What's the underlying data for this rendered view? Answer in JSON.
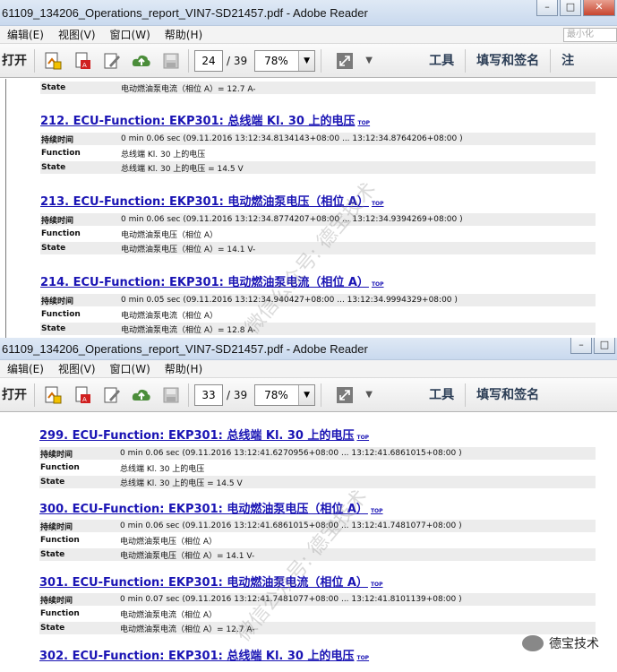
{
  "windows": [
    {
      "title": "61109_134206_Operations_report_VIN7-SD21457.pdf - Adobe Reader",
      "menu": [
        "编辑(E)",
        "视图(V)",
        "窗口(W)",
        "帮助(H)"
      ],
      "search_placeholder": "最小化",
      "open_label": "打开",
      "page_current": "24",
      "page_total": "/ 39",
      "zoom": "78%",
      "right_links": [
        "工具",
        "填写和签名",
        "注"
      ],
      "top_row": {
        "key": "State",
        "value": "电动燃油泵电流（相位 A）= 12.7 A-"
      },
      "sections": [
        {
          "title": "212. ECU-Function: EKP301: 总线端 Kl. 30 上的电压",
          "top": "TOP",
          "rows": [
            {
              "key": "持续时间",
              "value": "0 min 0.06 sec (09.11.2016 13:12:34.8134143+08:00 ... 13:12:34.8764206+08:00 )"
            },
            {
              "key": "Function",
              "value": "总线端 Kl. 30 上的电压"
            },
            {
              "key": "State",
              "value": "总线端 Kl. 30 上的电压 = 14.5 V"
            }
          ]
        },
        {
          "title": "213. ECU-Function: EKP301: 电动燃油泵电压（相位 A）",
          "top": "TOP",
          "rows": [
            {
              "key": "持续时间",
              "value": "0 min 0.06 sec (09.11.2016 13:12:34.8774207+08:00 ... 13:12:34.9394269+08:00 )"
            },
            {
              "key": "Function",
              "value": "电动燃油泵电压（相位 A）"
            },
            {
              "key": "State",
              "value": "电动燃油泵电压（相位 A）= 14.1 V-"
            }
          ]
        },
        {
          "title": "214. ECU-Function: EKP301: 电动燃油泵电流（相位 A）",
          "top": "TOP",
          "rows": [
            {
              "key": "持续时间",
              "value": "0 min 0.05 sec (09.11.2016 13:12:34.940427+08:00 ... 13:12:34.9994329+08:00 )"
            },
            {
              "key": "Function",
              "value": "电动燃油泵电流（相位 A）"
            },
            {
              "key": "State",
              "value": "电动燃油泵电流（相位 A）= 12.8 A-"
            }
          ]
        }
      ]
    },
    {
      "title": "61109_134206_Operations_report_VIN7-SD21457.pdf - Adobe Reader",
      "menu": [
        "编辑(E)",
        "视图(V)",
        "窗口(W)",
        "帮助(H)"
      ],
      "open_label": "打开",
      "page_current": "33",
      "page_total": "/ 39",
      "zoom": "78%",
      "right_links": [
        "工具",
        "填写和签名"
      ],
      "sections": [
        {
          "title": "299. ECU-Function: EKP301: 总线端 Kl. 30 上的电压",
          "top": "TOP",
          "rows": [
            {
              "key": "持续时间",
              "value": "0 min 0.06 sec (09.11.2016 13:12:41.6270956+08:00 ... 13:12:41.6861015+08:00 )"
            },
            {
              "key": "Function",
              "value": "总线端 Kl. 30 上的电压"
            },
            {
              "key": "State",
              "value": "总线端 Kl. 30 上的电压 = 14.5 V"
            }
          ]
        },
        {
          "title": "300. ECU-Function: EKP301: 电动燃油泵电压（相位 A）",
          "top": "TOP",
          "rows": [
            {
              "key": "持续时间",
              "value": "0 min 0.06 sec (09.11.2016 13:12:41.6861015+08:00 ... 13:12:41.7481077+08:00 )"
            },
            {
              "key": "Function",
              "value": "电动燃油泵电压（相位 A）"
            },
            {
              "key": "State",
              "value": "电动燃油泵电压（相位 A）= 14.1 V-"
            }
          ]
        },
        {
          "title": "301. ECU-Function: EKP301: 电动燃油泵电流（相位 A）",
          "top": "TOP",
          "rows": [
            {
              "key": "持续时间",
              "value": "0 min 0.07 sec (09.11.2016 13:12:41.7481077+08:00 ... 13:12:41.8101139+08:00 )"
            },
            {
              "key": "Function",
              "value": "电动燃油泵电流（相位 A）"
            },
            {
              "key": "State",
              "value": "电动燃油泵电流（相位 A）= 12.7 A-"
            }
          ]
        },
        {
          "title": "302. ECU-Function: EKP301: 总线端 Kl. 30 上的电压",
          "top": "TOP",
          "rows": []
        }
      ]
    }
  ],
  "watermark": "微信公众号: 德宝技术",
  "badge": "德宝技术"
}
